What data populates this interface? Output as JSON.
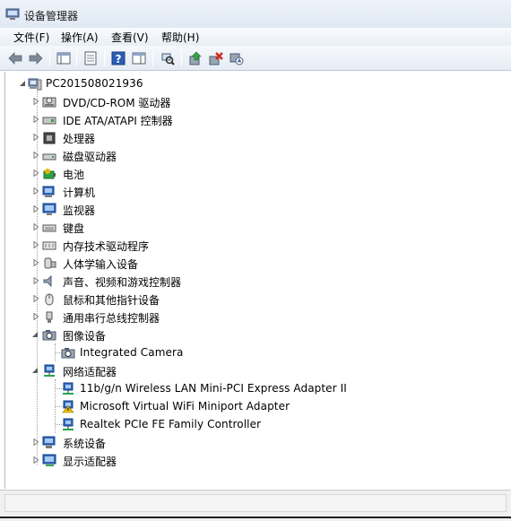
{
  "window": {
    "title": "设备管理器"
  },
  "menu": [
    {
      "label": "文件(F)"
    },
    {
      "label": "操作(A)"
    },
    {
      "label": "查看(V)"
    },
    {
      "label": "帮助(H)"
    }
  ],
  "toolbar": {
    "buttons": [
      "back-icon",
      "forward-icon",
      "show-hide-tree-icon",
      "properties-icon",
      "help-icon",
      "action-pane-icon",
      "scan-hardware-icon",
      "update-driver-icon",
      "uninstall-icon",
      "disable-icon"
    ]
  },
  "tree": {
    "root": "PC201508021936",
    "categories": [
      {
        "label": "DVD/CD-ROM 驱动器",
        "icon": "dvd-drive-icon"
      },
      {
        "label": "IDE ATA/ATAPI 控制器",
        "icon": "ide-controller-icon"
      },
      {
        "label": "处理器",
        "icon": "processor-icon"
      },
      {
        "label": "磁盘驱动器",
        "icon": "disk-drive-icon"
      },
      {
        "label": "电池",
        "icon": "battery-icon"
      },
      {
        "label": "计算机",
        "icon": "computer-icon"
      },
      {
        "label": "监视器",
        "icon": "monitor-icon"
      },
      {
        "label": "键盘",
        "icon": "keyboard-icon"
      },
      {
        "label": "内存技术驱动程序",
        "icon": "memory-icon"
      },
      {
        "label": "人体学输入设备",
        "icon": "hid-icon"
      },
      {
        "label": "声音、视频和游戏控制器",
        "icon": "sound-icon"
      },
      {
        "label": "鼠标和其他指针设备",
        "icon": "mouse-icon"
      },
      {
        "label": "通用串行总线控制器",
        "icon": "usb-icon"
      }
    ],
    "imaging": {
      "label": "图像设备",
      "children": [
        "Integrated Camera"
      ]
    },
    "network": {
      "label": "网络适配器",
      "children": [
        {
          "label": "11b/g/n  Wireless LAN Mini-PCI Express Adapter II",
          "warning": false
        },
        {
          "label": "Microsoft Virtual WiFi Miniport Adapter",
          "warning": true
        },
        {
          "label": "Realtek PCIe FE Family Controller",
          "warning": false
        }
      ]
    },
    "tail": [
      {
        "label": "系统设备",
        "icon": "system-devices-icon"
      },
      {
        "label": "显示适配器",
        "icon": "display-adapter-icon"
      }
    ]
  },
  "colors": {
    "accent": "#1f5fb8",
    "warning": "#f2c200"
  }
}
